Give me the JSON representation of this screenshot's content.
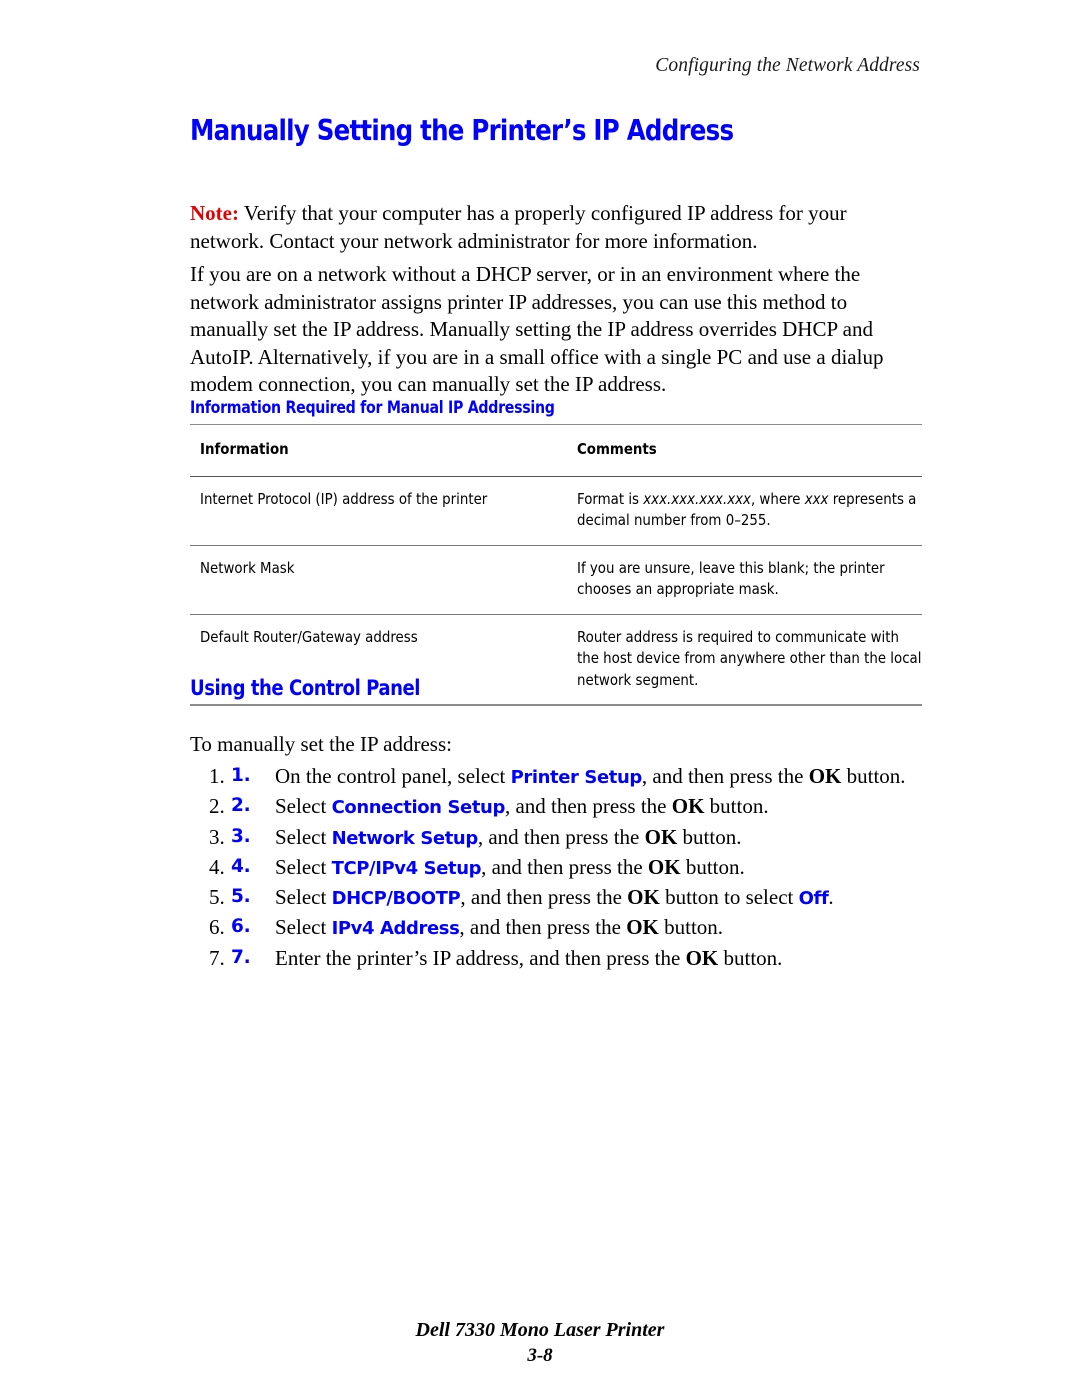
{
  "header": {
    "running_title": "Configuring the Network Address"
  },
  "title": "Manually Setting the Printer’s IP Address",
  "note": {
    "label": "Note:",
    "text": " Verify that your computer has a properly configured IP address for your network. Contact your network administrator for more information."
  },
  "intro_paragraph": "If you are on a network without a DHCP server, or in an environment where the network administrator assigns printer IP addresses, you can use this method to manually set the IP address. Manually setting the IP address overrides DHCP and AutoIP. Alternatively, if you are in a small office with a single PC and use a dialup modem connection, you can manually set the IP address.",
  "table": {
    "caption": "Information Required for Manual IP Addressing",
    "columns": [
      "Information",
      "Comments"
    ],
    "rows": [
      {
        "information": "Internet Protocol (IP) address of the printer",
        "comments_prefix": "Format is ",
        "comments_italic_1": "xxx.xxx.xxx.xxx",
        "comments_middle": ", where ",
        "comments_italic_2": "xxx",
        "comments_suffix": " represents a decimal number from 0–255."
      },
      {
        "information": "Network Mask",
        "comments": "If you are unsure, leave this blank; the printer chooses an appropriate mask."
      },
      {
        "information": "Default Router/Gateway address",
        "comments": "Router address is required to communicate with the host device from anywhere other than the local network segment."
      }
    ]
  },
  "control_panel": {
    "heading": "Using the Control Panel",
    "lead_in": "To manually set the IP address:",
    "steps": [
      {
        "number": "1.",
        "pre": "On the control panel, select ",
        "term": "Printer Setup",
        "mid": ", and then press the ",
        "key": "OK",
        "post": " button."
      },
      {
        "number": "2.",
        "pre": "Select ",
        "term": "Connection Setup",
        "mid": ", and then press the ",
        "key": "OK",
        "post": " button."
      },
      {
        "number": "3.",
        "pre": "Select ",
        "term": "Network Setup",
        "mid": ", and then press the ",
        "key": "OK",
        "post": " button."
      },
      {
        "number": "4.",
        "pre": "Select ",
        "term": "TCP/IPv4 Setup",
        "mid": ", and then press the ",
        "key": "OK",
        "post": " button."
      },
      {
        "number": "5.",
        "pre": "Select ",
        "term": "DHCP/BOOTP",
        "mid": ", and then press the ",
        "key": "OK",
        "post": " button to select ",
        "term2": "Off",
        "post2": "."
      },
      {
        "number": "6.",
        "pre": "Select ",
        "term": "IPv4 Address",
        "mid": ", and then press the ",
        "key": "OK",
        "post": " button."
      },
      {
        "number": "7.",
        "pre": "Enter the printer’s IP address, and then press the ",
        "term": "",
        "mid": "",
        "key": "OK",
        "post": " button."
      }
    ]
  },
  "footer": {
    "product": "Dell 7330 Mono Laser Printer",
    "page_number": "3-8"
  },
  "colors": {
    "heading_blue": "#0000FF",
    "note_red": "#E00000",
    "text_black": "#000000",
    "rule_gray": "#8D8D8D"
  }
}
